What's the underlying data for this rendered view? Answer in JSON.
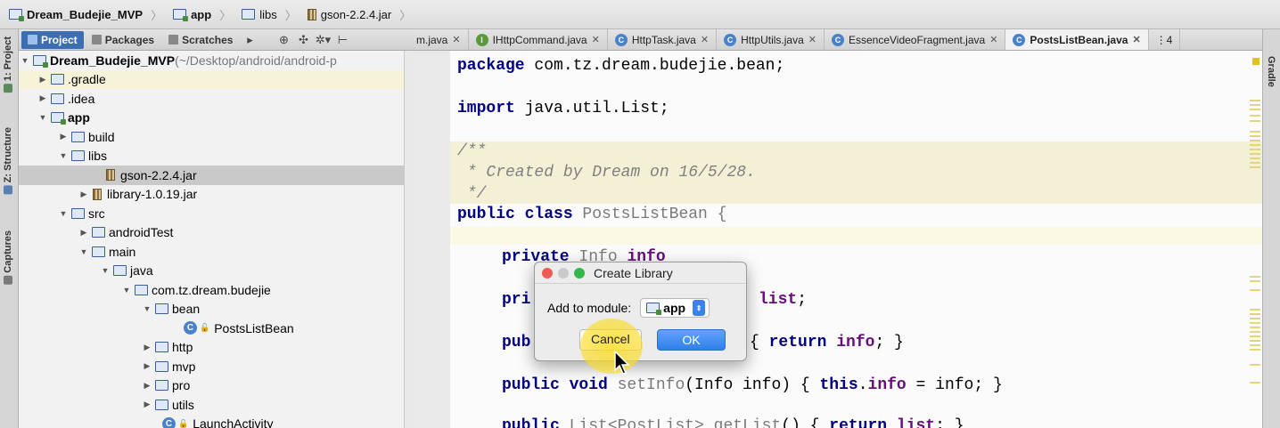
{
  "breadcrumb": [
    {
      "label": "Dream_Budejie_MVP",
      "icon": "module-folder-icon"
    },
    {
      "label": "app",
      "icon": "module-folder-icon"
    },
    {
      "label": "libs",
      "icon": "folder-icon"
    },
    {
      "label": "gson-2.2.4.jar",
      "icon": "jar-icon"
    }
  ],
  "left_stripe": {
    "project": "1: Project",
    "structure": "Z: Structure",
    "captures": "Captures"
  },
  "right_stripe": {
    "gradle": "Gradle"
  },
  "project_toolbar": {
    "project": "Project",
    "packages": "Packages",
    "scratches": "Scratches"
  },
  "tree": [
    {
      "label": "Dream_Budejie_MVP",
      "suffix": " (~/Desktop/android/android-p"
    },
    {
      "label": ".gradle"
    },
    {
      "label": ".idea"
    },
    {
      "label": "app"
    },
    {
      "label": "build"
    },
    {
      "label": "libs"
    },
    {
      "label": "gson-2.2.4.jar"
    },
    {
      "label": "library-1.0.19.jar"
    },
    {
      "label": "src"
    },
    {
      "label": "androidTest"
    },
    {
      "label": "main"
    },
    {
      "label": "java"
    },
    {
      "label": "com.tz.dream.budejie"
    },
    {
      "label": "bean"
    },
    {
      "label": "PostsListBean"
    },
    {
      "label": "http"
    },
    {
      "label": "mvp"
    },
    {
      "label": "pro"
    },
    {
      "label": "utils"
    },
    {
      "label": "LaunchActivity"
    }
  ],
  "editor_tabs": [
    {
      "label": "m.java",
      "icon": "class"
    },
    {
      "label": "IHttpCommand.java",
      "icon": "interface"
    },
    {
      "label": "HttpTask.java",
      "icon": "class"
    },
    {
      "label": "HttpUtils.java",
      "icon": "class"
    },
    {
      "label": "EssenceVideoFragment.java",
      "icon": "class"
    },
    {
      "label": "PostsListBean.java",
      "icon": "class"
    }
  ],
  "tab_overflow": "⋮4",
  "code": {
    "l1_kw": "package",
    "l1_rest": " com.tz.dream.budejie.bean;",
    "l2_kw": "import",
    "l2_rest": " java.util.List;",
    "l3": "/**",
    "l4": " * Created by Dream on 16/5/28.",
    "l5": " */",
    "l6_kw": "public class",
    "l6_rest": " PostsListBean {",
    "l7_kw": "private",
    "l7_type": " Info ",
    "l7_field": "info",
    "l8_kw": "pri",
    "l8_field": "list",
    "l9_kw": "pub",
    "l9_rest": "{ ",
    "l9_ret": "return",
    "l9_field": "info",
    "l10_kw": "public void",
    "l10_name": " setInfo",
    "l10_rest": "(Info info) { ",
    "l10_this": "this",
    "l10_field": "info",
    "l10_tail": " = info; }",
    "l11_kw": "public",
    "l11_rest": " List<PostList> ",
    "l11_name": "getList",
    "l11_tail": "() { ",
    "l11_ret": "return",
    "l11_field": "list",
    "l11_end": "; }"
  },
  "dialog": {
    "title": "Create Library",
    "label": "Add to module:",
    "module": "app",
    "cancel": "Cancel",
    "ok": "OK"
  }
}
